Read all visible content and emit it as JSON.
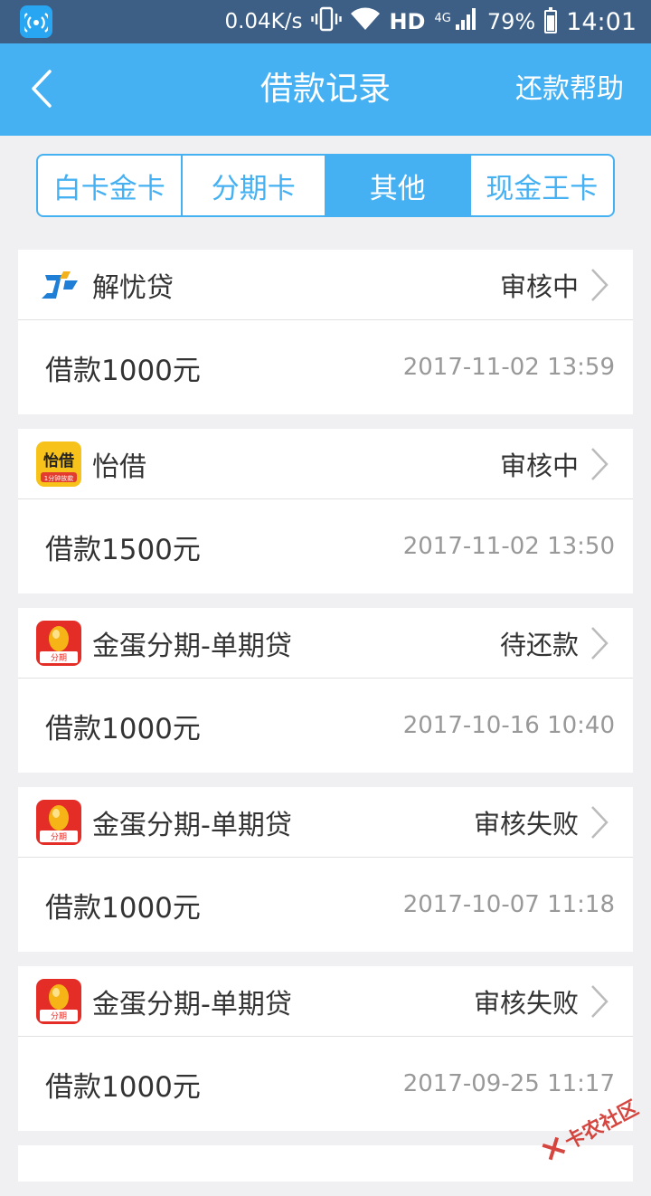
{
  "status_bar": {
    "app_icon": "wifi-hotspot-icon",
    "speed": "0.04K/s",
    "vibrate_icon": "vibrate-icon",
    "wifi_icon": "wifi-icon",
    "hd": "HD",
    "network": "4G",
    "signal_icon": "signal-icon",
    "battery": "79%",
    "time": "14:01"
  },
  "header": {
    "back_icon": "chevron-left-icon",
    "title": "借款记录",
    "help": "还款帮助"
  },
  "tabs": [
    {
      "label": "白卡金卡",
      "active": false
    },
    {
      "label": "分期卡",
      "active": false
    },
    {
      "label": "其他",
      "active": true
    },
    {
      "label": "现金王卡",
      "active": false
    }
  ],
  "records": [
    {
      "logo": "jieyoudai-logo",
      "name": "解忧贷",
      "status": "审核中",
      "amount": "借款1000元",
      "date": "2017-11-02 13:59"
    },
    {
      "logo": "yijie-logo",
      "name": "怡借",
      "status": "审核中",
      "amount": "借款1500元",
      "date": "2017-11-02 13:50"
    },
    {
      "logo": "jindan-logo",
      "name": "金蛋分期-单期贷",
      "status": "待还款",
      "amount": "借款1000元",
      "date": "2017-10-16 10:40"
    },
    {
      "logo": "jindan-logo",
      "name": "金蛋分期-单期贷",
      "status": "审核失败",
      "amount": "借款1000元",
      "date": "2017-10-07 11:18"
    },
    {
      "logo": "jindan-logo",
      "name": "金蛋分期-单期贷",
      "status": "审核失败",
      "amount": "借款1000元",
      "date": "2017-09-25 11:17"
    }
  ],
  "logo_text": {
    "yijie": "怡借",
    "yijie_sub": "1分钟放款",
    "jindan": "分期"
  },
  "watermark": "卡农社区",
  "colors": {
    "primary": "#46b1f2",
    "status_bar": "#3d5f86",
    "background": "#f0f0f2",
    "date_text": "#999999"
  }
}
